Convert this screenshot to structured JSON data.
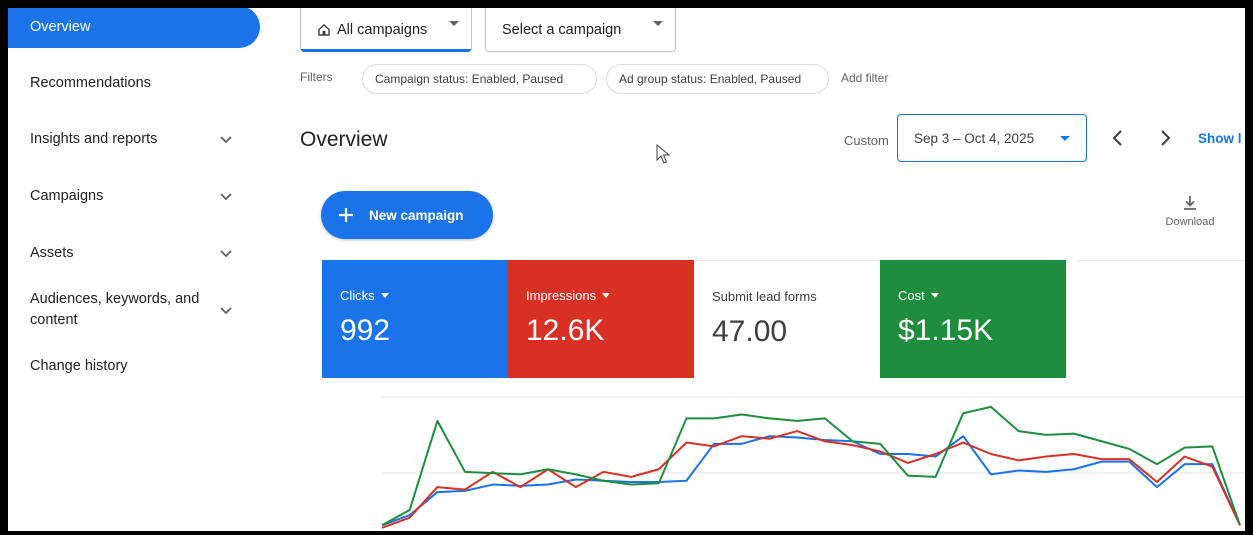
{
  "sidebar": {
    "items": [
      {
        "label": "Overview",
        "active": true,
        "has_chevron": false
      },
      {
        "label": "Recommendations",
        "active": false,
        "has_chevron": false
      },
      {
        "label": "Insights and reports",
        "active": false,
        "has_chevron": true
      },
      {
        "label": "Campaigns",
        "active": false,
        "has_chevron": true
      },
      {
        "label": "Assets",
        "active": false,
        "has_chevron": true
      },
      {
        "label": "Audiences, keywords, and content",
        "active": false,
        "has_chevron": true
      },
      {
        "label": "Change history",
        "active": false,
        "has_chevron": false
      }
    ]
  },
  "toolbar": {
    "view_selector": {
      "value": "All campaigns",
      "icon": "home-icon"
    },
    "campaign_selector": {
      "value": "Select a campaign"
    }
  },
  "filters": {
    "label": "Filters",
    "chips": [
      "Campaign status: Enabled, Paused",
      "Ad group status: Enabled, Paused"
    ],
    "add_filter": "Add filter"
  },
  "header": {
    "title": "Overview",
    "range_type": "Custom",
    "date_range": "Sep 3 – Oct 4, 2025",
    "show_link": "Show l"
  },
  "actions": {
    "new_campaign": "New campaign",
    "download": "Download"
  },
  "metrics": [
    {
      "label": "Clicks",
      "value": "992",
      "color": "#1a73e8",
      "dropdown": true
    },
    {
      "label": "Impressions",
      "value": "12.6K",
      "color": "#d93025",
      "dropdown": true
    },
    {
      "label": "Submit lead forms",
      "value": "47.00",
      "color": "#ffffff",
      "dropdown": false
    },
    {
      "label": "Cost",
      "value": "$1.15K",
      "color": "#1e8e3e",
      "dropdown": true
    }
  ],
  "chart_data": {
    "type": "line",
    "x": [
      1,
      2,
      3,
      4,
      5,
      6,
      7,
      8,
      9,
      10,
      11,
      12,
      13,
      14,
      15,
      16,
      17,
      18,
      19,
      20,
      21,
      22,
      23,
      24,
      25,
      26,
      27,
      28,
      29,
      30,
      31,
      32
    ],
    "series": [
      {
        "color": "#1a73e8",
        "values": [
          10,
          18,
          36,
          37,
          42,
          41,
          42,
          46,
          45,
          44,
          44,
          45,
          74,
          74,
          80,
          79,
          77,
          76,
          66,
          66,
          64,
          80,
          50,
          53,
          52,
          54,
          60,
          60,
          40,
          58,
          58,
          10
        ]
      },
      {
        "color": "#d93025",
        "values": [
          8,
          16,
          40,
          38,
          52,
          40,
          54,
          40,
          52,
          48,
          54,
          75,
          72,
          80,
          78,
          84,
          76,
          73,
          68,
          59,
          66,
          75,
          66,
          61,
          64,
          66,
          62,
          62,
          44,
          64,
          56,
          10
        ]
      },
      {
        "color": "#1e8e3e",
        "values": [
          10,
          22,
          92,
          52,
          51,
          50,
          54,
          50,
          45,
          42,
          43,
          94,
          94,
          97,
          94,
          92,
          94,
          76,
          74,
          49,
          48,
          98,
          103,
          84,
          81,
          82,
          76,
          70,
          58,
          71,
          72,
          10
        ]
      }
    ]
  }
}
